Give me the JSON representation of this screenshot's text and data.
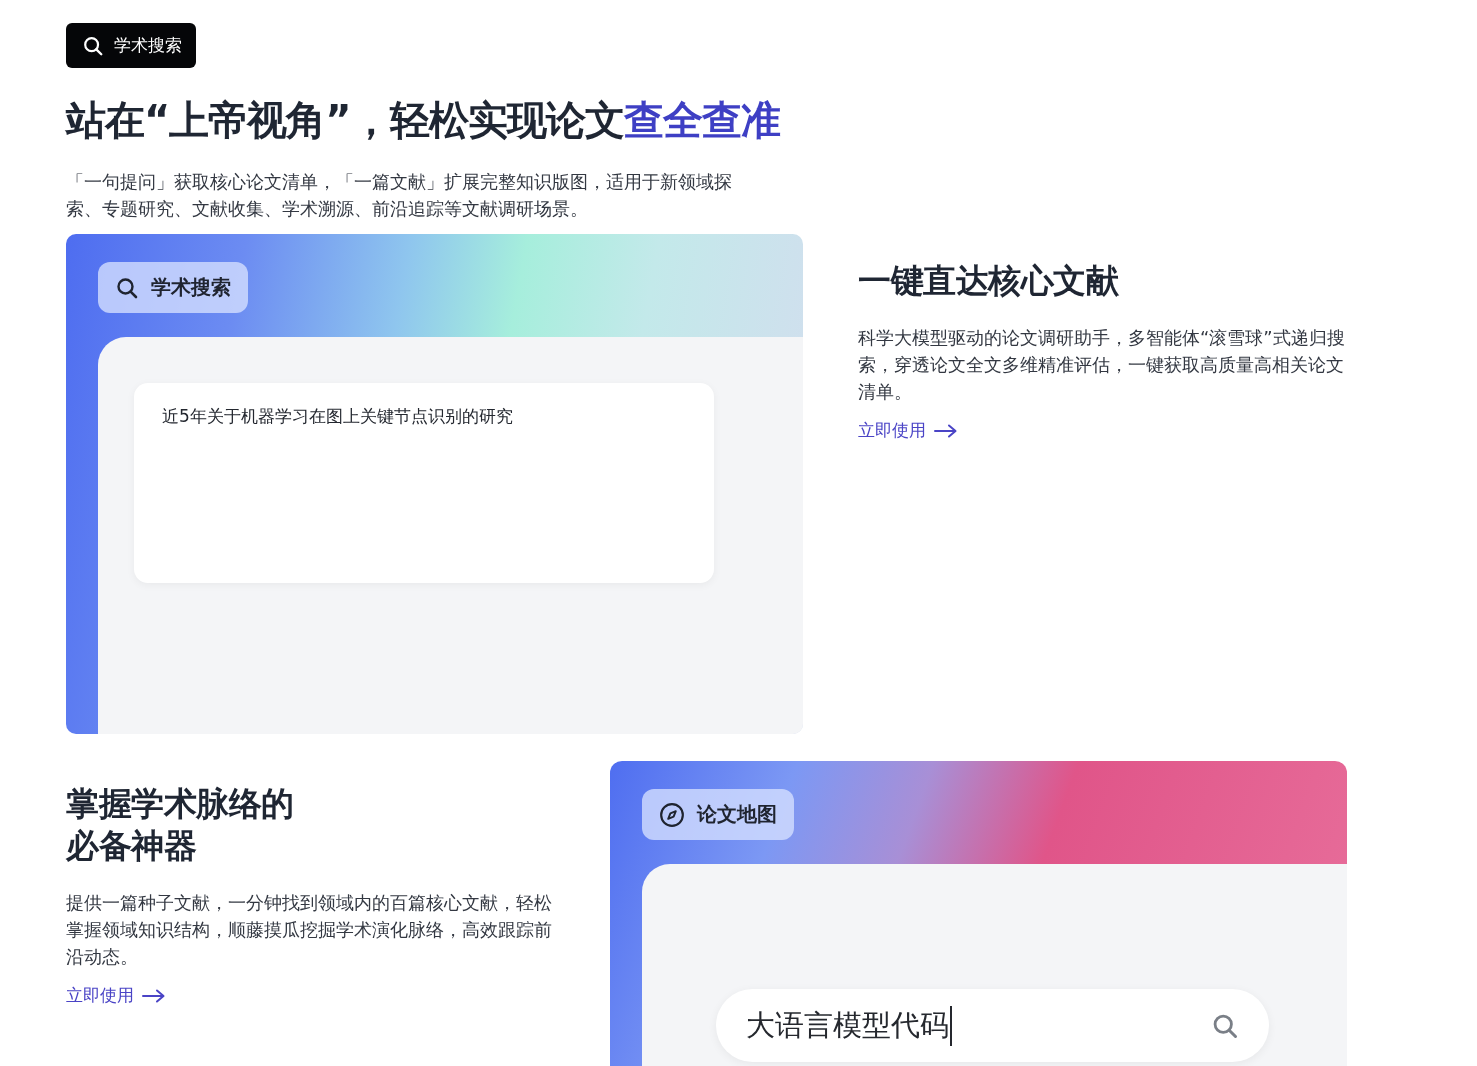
{
  "top_badge": {
    "label": "学术搜索"
  },
  "headline": {
    "text": "站在“上帝视角”，轻松实现论文",
    "highlight": "查全查准"
  },
  "intro": "「一句提问」获取核心论文清单，「一篇文献」扩展完整知识版图，适用于新领域探索、专题研究、文献收集、学术溯源、前沿追踪等文献调研场景。",
  "features": [
    {
      "kind": "query",
      "chip": "学术搜索",
      "query": "近5年关于机器学习在图上关键节点识别的研究",
      "title": "一键直达核心文献",
      "description": "科学大模型驱动的论文调研助手，多智能体“滚雪球”式递归搜索，穿透论文全文多维精准评估，一键获取高质量高相关论文清单。",
      "link": "立即使用"
    },
    {
      "kind": "search",
      "chip": "论文地图",
      "query": "大语言模型代码",
      "title": "掌握学术脉络的必备神器",
      "description": "提供一篇种子文献，一分钟找到领域内的百篇核心文献，轻松掌握领域知识结构，顺藤摸瓜挖掘学术演化脉络，高效跟踪前沿动态。",
      "link": "立即使用"
    }
  ]
}
